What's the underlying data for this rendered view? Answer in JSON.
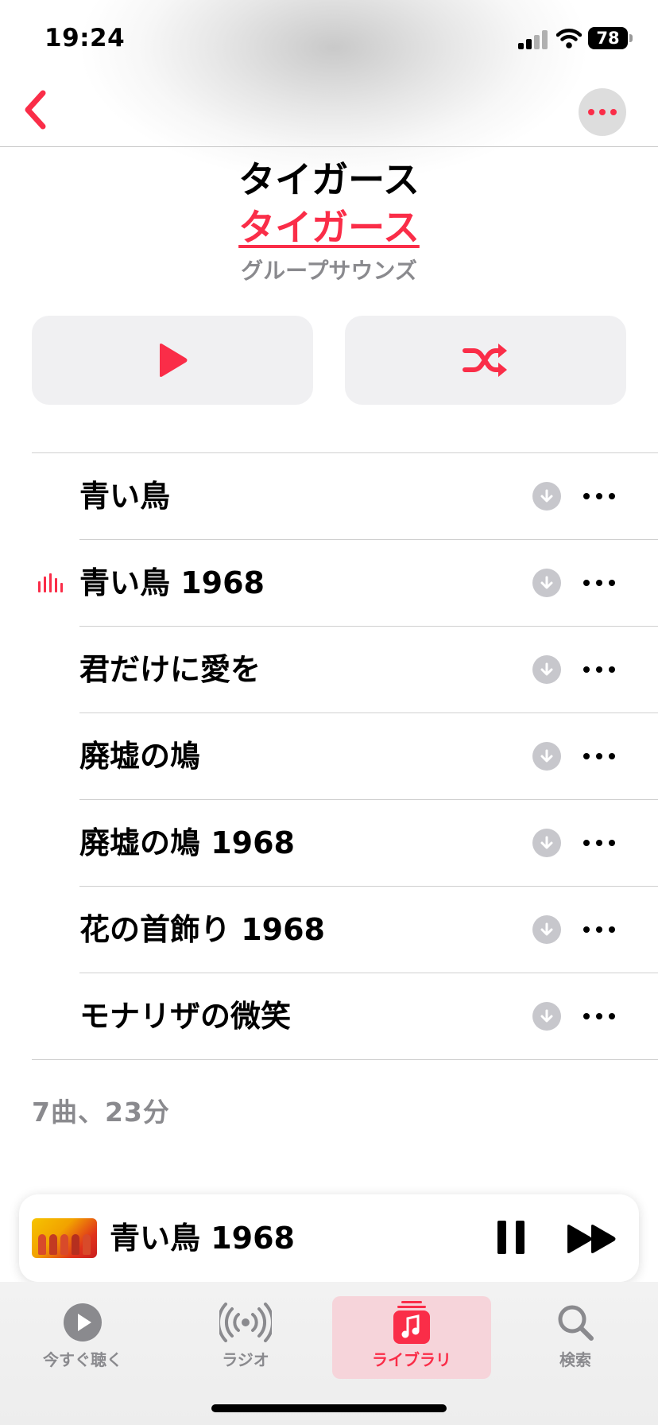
{
  "status_bar": {
    "time": "19:24",
    "battery": "78"
  },
  "album": {
    "title": "タイガース",
    "artist": "タイガース",
    "genre": "グループサウンズ"
  },
  "tracks": [
    {
      "title": "青い鳥",
      "now_playing": false
    },
    {
      "title": "青い鳥 1968",
      "now_playing": true
    },
    {
      "title": "君だけに愛を",
      "now_playing": false
    },
    {
      "title": "廃墟の鳩",
      "now_playing": false
    },
    {
      "title": "廃墟の鳩 1968",
      "now_playing": false
    },
    {
      "title": "花の首飾り 1968",
      "now_playing": false
    },
    {
      "title": "モナリザの微笑",
      "now_playing": false
    }
  ],
  "summary": "7曲、23分",
  "mini_player": {
    "title": "青い鳥 1968"
  },
  "tab_bar": {
    "items": [
      {
        "label": "今すぐ聴く",
        "icon": "play-circle-icon",
        "active": false
      },
      {
        "label": "ラジオ",
        "icon": "radio-waves-icon",
        "active": false
      },
      {
        "label": "ライブラリ",
        "icon": "music-library-icon",
        "active": true
      },
      {
        "label": "検索",
        "icon": "search-icon",
        "active": false
      }
    ]
  },
  "colors": {
    "accent": "#fa2d48",
    "secondary_text": "#8a8a8e"
  }
}
